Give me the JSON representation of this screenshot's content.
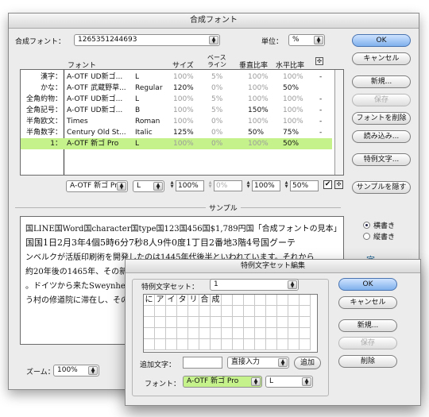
{
  "main": {
    "title": "合成フォント",
    "font_label": "合成フォント：",
    "font_value": "1265351244693",
    "unit_label": "単位：",
    "unit_value": "%",
    "headers": {
      "font": "フォント",
      "size": "サイズ",
      "baseline_1": "ベース",
      "baseline_2": "ライン",
      "vscale": "垂直比率",
      "hscale": "水平比率"
    },
    "rows": [
      {
        "cat": "漢字：",
        "font": "A-OTF UD新ゴ...",
        "style": "L",
        "size": "100%",
        "base": "5%",
        "v": "100%",
        "h": "100%",
        "x": "-"
      },
      {
        "cat": "かな：",
        "font": "A-OTF 武蔵野草...",
        "style": "Regular",
        "size": "120%",
        "base": "0%",
        "v": "100%",
        "h": "50%",
        "x": ""
      },
      {
        "cat": "全角約物：",
        "font": "A-OTF UD新ゴ...",
        "style": "L",
        "size": "100%",
        "base": "5%",
        "v": "100%",
        "h": "100%",
        "x": "-"
      },
      {
        "cat": "全角記号：",
        "font": "A-OTF UD新ゴ...",
        "style": "B",
        "size": "100%",
        "base": "5%",
        "v": "150%",
        "h": "100%",
        "x": "-"
      },
      {
        "cat": "半角欧文：",
        "font": "Times",
        "style": "Roman",
        "size": "100%",
        "base": "0%",
        "v": "100%",
        "h": "100%",
        "x": "-"
      },
      {
        "cat": "半角数字：",
        "font": "Century Old St...",
        "style": "Italic",
        "size": "125%",
        "base": "0%",
        "v": "50%",
        "h": "75%",
        "x": "-"
      },
      {
        "cat": "1：",
        "font": "A-OTF 新ゴ Pro",
        "style": "L",
        "size": "100%",
        "base": "0%",
        "v": "100%",
        "h": "50%",
        "x": ""
      }
    ],
    "edit": {
      "font": "A-OTF 新ゴ Pro",
      "style": "L",
      "size": "100%",
      "base": "0%",
      "v": "100%",
      "h": "50%"
    },
    "buttons": {
      "ok": "OK",
      "cancel": "キャンセル",
      "new": "新規...",
      "save": "保存",
      "delete_font": "フォントを削除",
      "load": "読み込み...",
      "special_chars": "特例文字...",
      "hide_sample": "サンプルを隠す"
    },
    "sample_label": "サンプル",
    "sample_lines": [
      "国LINE国Word国character国type国123国456国$1,789円国「合成フォントの見本」",
      "国国1日2月3年4個5時6分7秒8人9件0度1丁目2番地3階4号国グーテ",
      "ンベルクが活版印刷術を開発したのは1445年代後半といわれています。それから",
      "約20年後の1465年、その新しい技術は",
      "。ドイツから来たSweynheym",
      "う村の修道院に滞在し、その"
    ],
    "radio_horizontal": "横書き",
    "radio_vertical": "縦書き",
    "side_glyph": "字",
    "zoom_label": "ズーム：",
    "zoom_value": "100%"
  },
  "sub": {
    "title": "特例文字セット編集",
    "set_label": "特例文字セット：",
    "set_value": "1",
    "chars": [
      "に",
      "ア",
      "イ",
      "タ",
      "リ",
      "合",
      "成"
    ],
    "add_label": "追加文字：",
    "add_value": "",
    "input_mode": "直接入力",
    "add_button": "追加",
    "font_label": "フォント：",
    "font_value": "A-OTF 新ゴ Pro",
    "style_value": "L",
    "buttons": {
      "ok": "OK",
      "cancel": "キャンセル",
      "new": "新規...",
      "save": "保存",
      "delete": "削除"
    }
  },
  "colors": {
    "selected_row": "#c6f28c",
    "accent": "#7fb0ec"
  }
}
